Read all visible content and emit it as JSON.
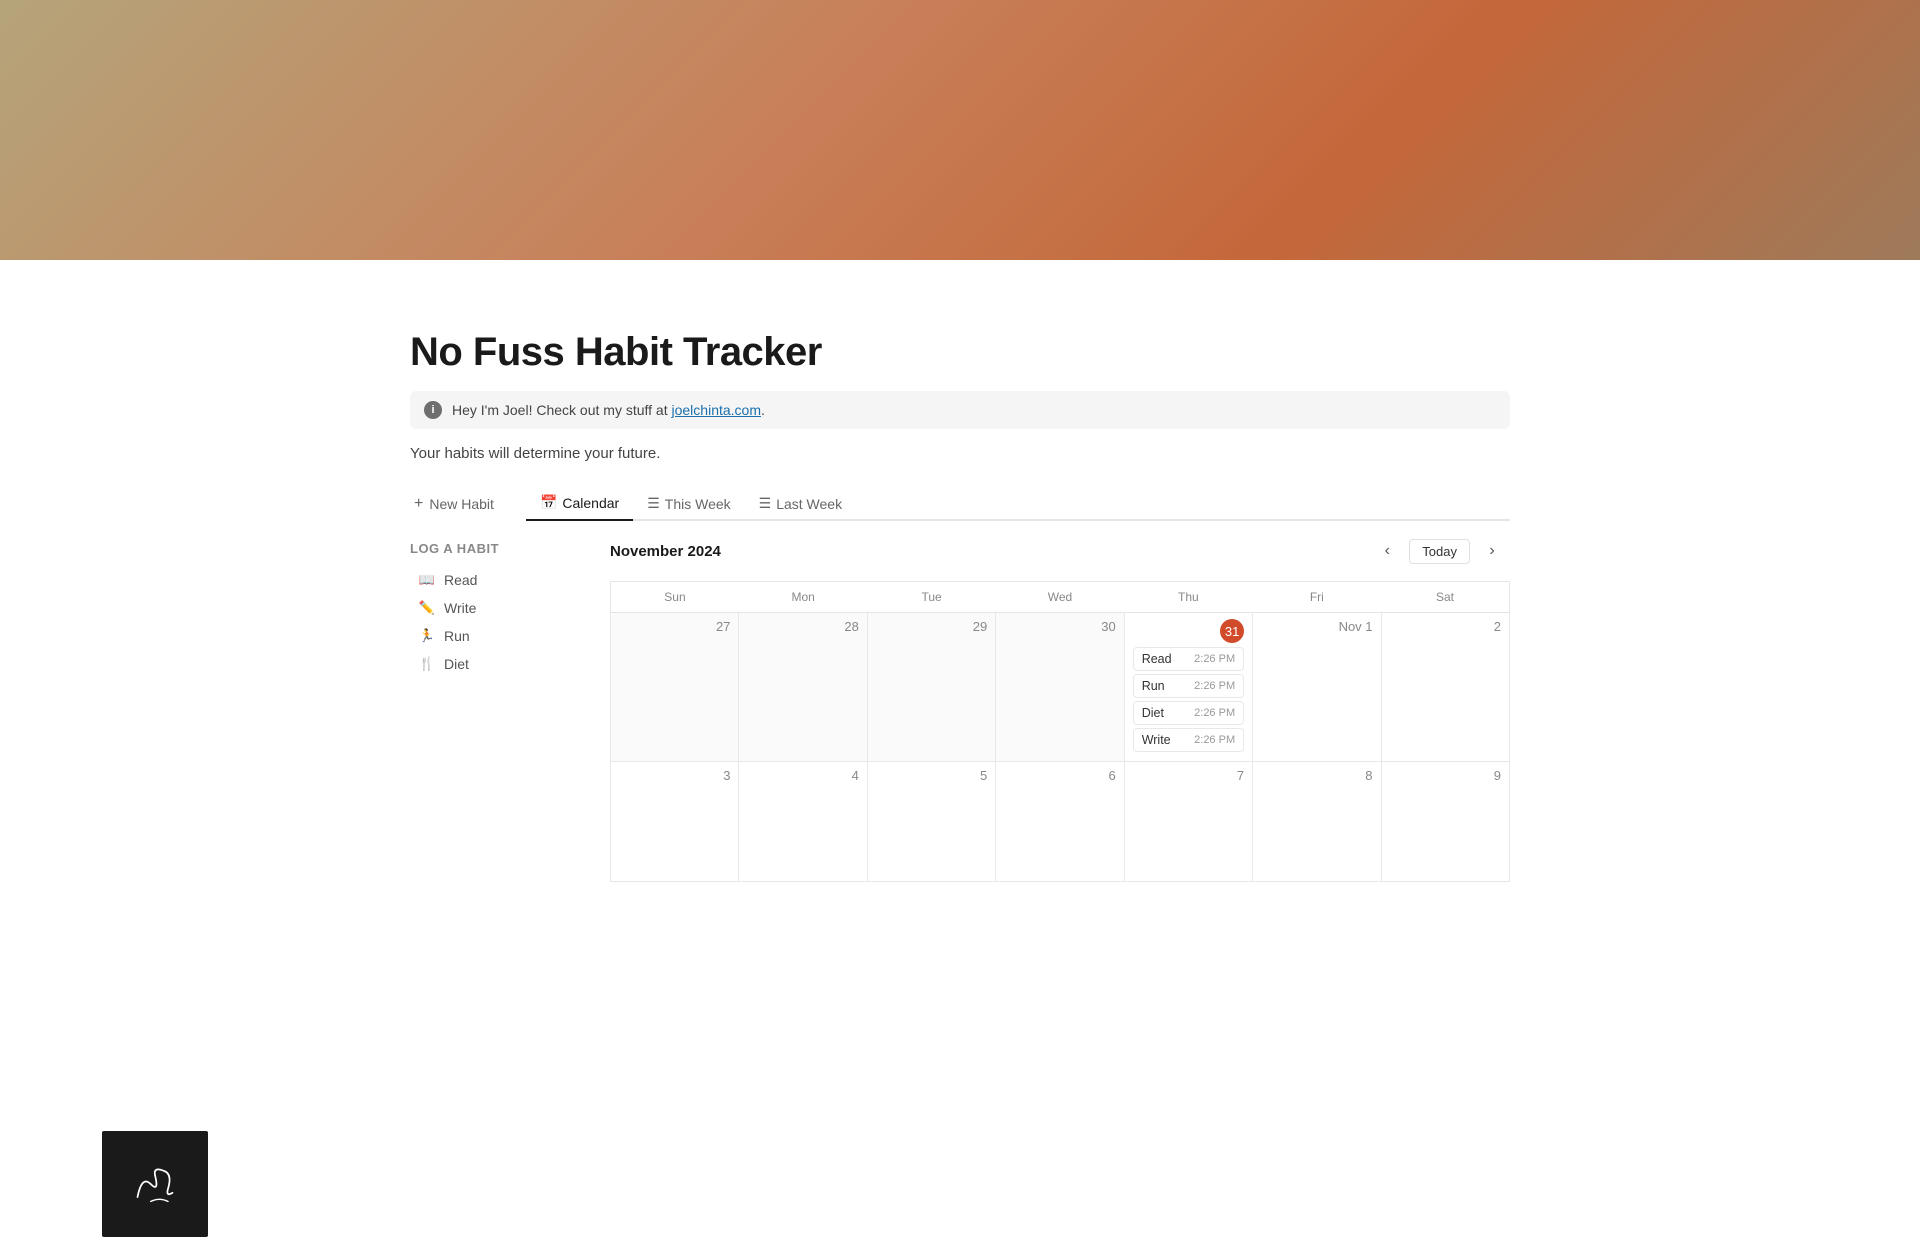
{
  "hero": {
    "banner_gradient": "linear-gradient(135deg, #b5a47a 0%, #c8815a 40%, #c4673a 70%, #9e7a5a 100%)"
  },
  "page": {
    "title": "No Fuss Habit Tracker",
    "tagline": "Your habits will determine your future."
  },
  "info_banner": {
    "text_before": "Hey I'm Joel! Check out my stuff at ",
    "link_text": "joelchinta.com",
    "text_after": "."
  },
  "toolbar": {
    "new_habit_label": "New Habit"
  },
  "views": [
    {
      "id": "calendar",
      "label": "Calendar",
      "icon": "📅",
      "active": true
    },
    {
      "id": "this-week",
      "label": "This Week",
      "icon": "☰",
      "active": false
    },
    {
      "id": "last-week",
      "label": "Last Week",
      "icon": "☰",
      "active": false
    }
  ],
  "sidebar": {
    "section_title": "Log a Habit",
    "habits": [
      {
        "name": "Read",
        "icon": "📖"
      },
      {
        "name": "Write",
        "icon": "✏️"
      },
      {
        "name": "Run",
        "icon": "🏃"
      },
      {
        "name": "Diet",
        "icon": "🍴"
      }
    ]
  },
  "calendar": {
    "month": "November 2024",
    "today_label": "Today",
    "days": [
      "Sun",
      "Mon",
      "Tue",
      "Wed",
      "Thu",
      "Fri",
      "Sat"
    ],
    "weeks": [
      [
        {
          "num": "27",
          "other": true,
          "events": []
        },
        {
          "num": "28",
          "other": true,
          "events": []
        },
        {
          "num": "29",
          "other": true,
          "events": []
        },
        {
          "num": "30",
          "other": true,
          "events": []
        },
        {
          "num": "31",
          "today": true,
          "events": [
            {
              "name": "Read",
              "time": "2:26 PM"
            },
            {
              "name": "Run",
              "time": "2:26 PM"
            },
            {
              "name": "Diet",
              "time": "2:26 PM"
            },
            {
              "name": "Write",
              "time": "2:26 PM"
            }
          ]
        },
        {
          "num": "Nov 1",
          "events": []
        },
        {
          "num": "2",
          "events": []
        }
      ],
      [
        {
          "num": "3",
          "events": []
        },
        {
          "num": "4",
          "events": []
        },
        {
          "num": "5",
          "events": []
        },
        {
          "num": "6",
          "events": []
        },
        {
          "num": "7",
          "events": []
        },
        {
          "num": "8",
          "events": []
        },
        {
          "num": "9",
          "events": []
        }
      ]
    ]
  }
}
